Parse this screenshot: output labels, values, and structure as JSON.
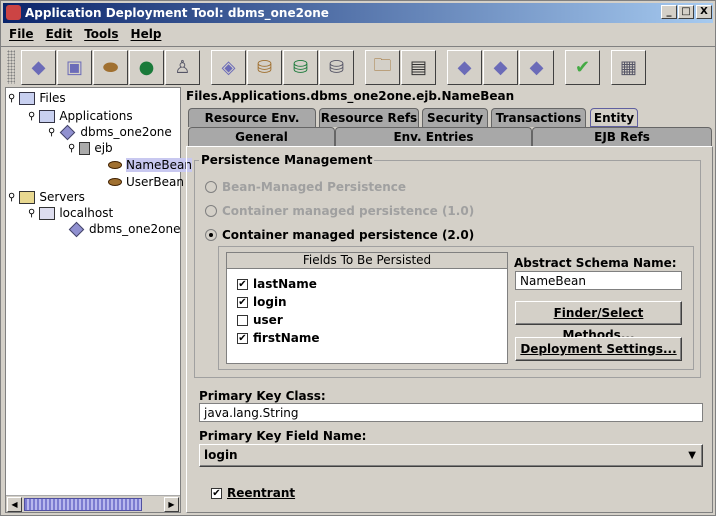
{
  "window": {
    "title": "Application Deployment Tool: dbms_one2one",
    "minimize": "_",
    "maximize": "□",
    "close": "X"
  },
  "menu": [
    "File",
    "Edit",
    "Tools",
    "Help"
  ],
  "toolbar": [
    "new-application-icon",
    "new-ejb-icon",
    "new-bean-icon",
    "new-web-icon",
    "new-client-icon",
    "add-ejb-icon",
    "add-bean-jar-icon",
    "add-web-jar-icon",
    "add-client-jar-icon",
    "open-icon",
    "save-icon",
    "deploy-icon",
    "undeploy-icon",
    "update-icon",
    "verify-icon",
    "descriptor-viewer-icon"
  ],
  "tree": {
    "files": "Files",
    "applications": "Applications",
    "app": "dbms_one2one",
    "ejb": "ejb",
    "bean1": "NameBean",
    "bean2": "UserBean",
    "servers": "Servers",
    "localhost": "localhost",
    "deployed": "dbms_one2one"
  },
  "breadcrumb": "Files.Applications.dbms_one2one.ejb.NameBean",
  "tabs_row1": [
    "Resource Env. Refs",
    "Resource Refs",
    "Security",
    "Transactions",
    "Entity"
  ],
  "tabs_row2": [
    "General",
    "Env. Entries",
    "EJB Refs"
  ],
  "active_tab": "Entity",
  "persistence": {
    "title": "Persistence Management",
    "options": [
      "Bean-Managed Persistence",
      "Container managed persistence (1.0)",
      "Container managed persistence (2.0)"
    ],
    "selected": 2,
    "fields_header": "Fields To Be Persisted",
    "fields": [
      {
        "name": "lastName",
        "checked": true
      },
      {
        "name": "login",
        "checked": true
      },
      {
        "name": "user",
        "checked": false
      },
      {
        "name": "firstName",
        "checked": true
      }
    ],
    "schema_label": "Abstract Schema Name:",
    "schema_value": "NameBean",
    "finder_button": "Finder/Select Methods...",
    "deploy_button": "Deployment Settings..."
  },
  "pk_class_label": "Primary Key Class:",
  "pk_class_value": "java.lang.String",
  "pk_field_label": "Primary Key Field Name:",
  "pk_field_value": "login",
  "reentrant": {
    "label": "Reentrant",
    "checked": true
  }
}
